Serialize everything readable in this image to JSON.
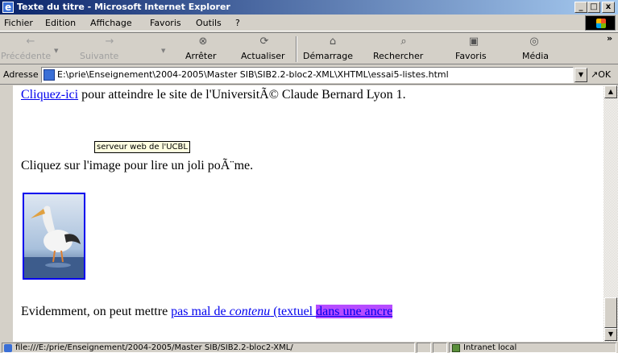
{
  "window": {
    "title": "Texte du titre - Microsoft Internet Explorer",
    "min_glyph": "_",
    "max_glyph": "□",
    "close_glyph": "x"
  },
  "menu": {
    "items": [
      "Fichier",
      "Edition",
      "Affichage",
      "Favoris",
      "Outils",
      "?"
    ]
  },
  "toolbar": {
    "back": {
      "label": "Précédente",
      "icon": "back-arrow-icon"
    },
    "forward": {
      "label": "Suivante",
      "icon": "forward-arrow-icon"
    },
    "stop": {
      "label": "Arrêter",
      "icon": "stop-icon"
    },
    "refresh": {
      "label": "Actualiser",
      "icon": "refresh-icon"
    },
    "home": {
      "label": "Démarrage",
      "icon": "home-icon"
    },
    "search": {
      "label": "Rechercher",
      "icon": "search-icon"
    },
    "favorites": {
      "label": "Favoris",
      "icon": "favorites-icon"
    },
    "media": {
      "label": "Média",
      "icon": "media-icon"
    },
    "more": "»"
  },
  "address": {
    "label": "Adresse",
    "url": "E:\\prie\\Enseignement\\2004-2005\\Master SIB\\SIB2.2-bloc2-XML\\XHTML\\essai5-listes.html",
    "go_label": "OK"
  },
  "content": {
    "line1": {
      "link": "Cliquez-ici",
      "rest": " pour atteindre le site de l'UniversitÃ© Claude Bernard Lyon 1."
    },
    "tooltip": "serveur web de l'UCBL",
    "line2": "Cliquez sur l'image pour lire un joli poÃ¨me.",
    "line3": {
      "prefix": "Evidemment, on peut mettre ",
      "link_part1": "pas mal de ",
      "link_em": "contenu",
      "link_part2": " (textuel ",
      "link_highlight": "dans une ancre"
    }
  },
  "status": {
    "url": "file:///E:/prie/Enseignement/2004-2005/Master SIB/SIB2.2-bloc2-XML/",
    "zone": "Intranet local"
  }
}
